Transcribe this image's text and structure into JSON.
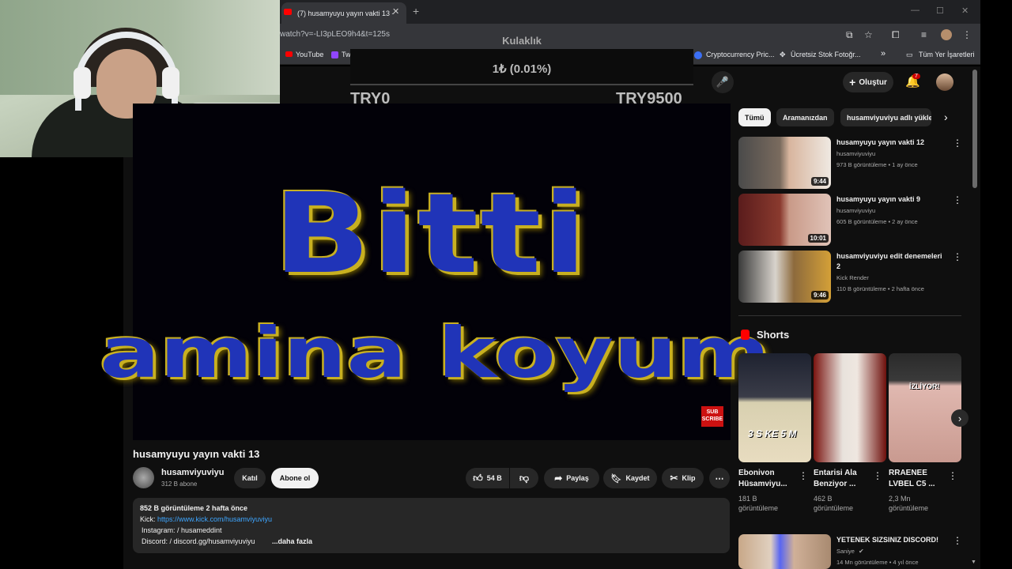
{
  "browser": {
    "tab_title": "(7) husamyuyu yayın vakti 13 -",
    "tab_close": "✕",
    "new_tab": "+",
    "win_min": "—",
    "win_max": "☐",
    "win_close": "✕",
    "url": "watch?v=-LI3pLEO9h4&t=125s",
    "bookmarks": [
      "YouTube",
      "Tw",
      "Cryptocurrency Pric...",
      "Ücretsiz Stok Fotoğr...",
      "»",
      "Tüm Yer İşaretleri"
    ]
  },
  "goal_overlay": {
    "title": "Kulaklık",
    "value": "1₺ (0.01%)",
    "min": "TRY0",
    "max": "TRY9500"
  },
  "header": {
    "create_label": "Oluştur",
    "notification_count": "7"
  },
  "video": {
    "overlay_line1": "Bitti",
    "overlay_line2": "amina koyum",
    "subscribe_badge_1": "SUB",
    "subscribe_badge_2": "SCRIBE",
    "title": "husamyuyu yayın vakti 13",
    "channel_name": "husamviyuviyu",
    "channel_subs": "312 B abone",
    "join_label": "Katıl",
    "subscribe_label": "Abone ol",
    "likes": "54 B",
    "share_label": "Paylaş",
    "save_label": "Kaydet",
    "clip_label": "Klip",
    "more": "⋯"
  },
  "description": {
    "stats": "852 B görüntüleme  2 hafta önce",
    "kick_prefix": "Kick: ",
    "kick_link": "https://www.kick.com/husamviyuviyu",
    "instagram": "Instagram:   / husameddint",
    "discord": "Discord:   / discord.gg/husamviyuviyu",
    "more": "...daha fazla"
  },
  "chips": [
    "Tümü",
    "Aramanızdan",
    "husamviyuviyu adlı yükle"
  ],
  "related": [
    {
      "title": "husamyuyu yayın vakti 12",
      "channel": "husamviyuviyu",
      "meta": "973 B görüntüleme • 1 ay önce",
      "duration": "9:44"
    },
    {
      "title": "husamyuyu yayın vakti 9",
      "channel": "husamviyuviyu",
      "meta": "605 B görüntüleme • 2 ay önce",
      "duration": "10:01"
    },
    {
      "title": "husamviyuviyu edit denemeleri 2",
      "channel": "Kick Render",
      "meta": "110 B görüntüleme • 2 hafta önce",
      "duration": "9:46"
    }
  ],
  "shorts": {
    "title": "Shorts",
    "items": [
      {
        "title": "Ebonivon Hüsamviyu...",
        "views": "181 B görüntüleme",
        "overlay": "3 S KE 5 M"
      },
      {
        "title": "Entarisi Ala Benziyor ...",
        "views": "462 B görüntüleme",
        "overlay": ""
      },
      {
        "title": "RRAENEE LVBEL C5 ...",
        "views": "2,3 Mn görüntüleme",
        "overlay": "İZLİYOR!"
      }
    ]
  },
  "last_related": {
    "title": "YETENEK SIZSINIZ DISCORD!",
    "channel": "Saniye",
    "meta": "14 Mn görüntüleme • 4 yıl önce"
  },
  "colors": {
    "accent": "#ff0000",
    "bg": "#0f0f0f",
    "link": "#3ea6ff"
  }
}
